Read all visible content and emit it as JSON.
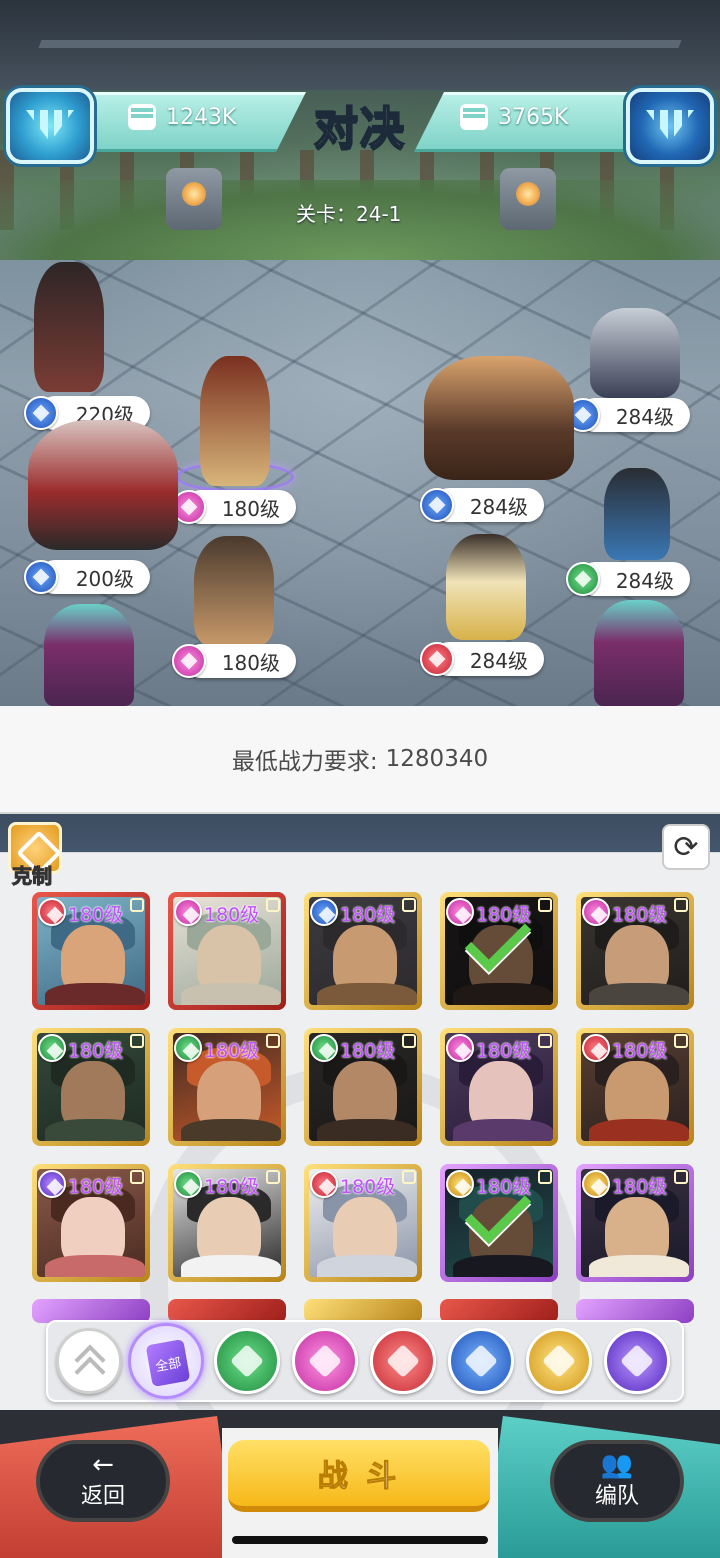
{
  "header": {
    "left_power": "1243K",
    "right_power": "3765K",
    "title": "对决",
    "stage": "关卡：24-1"
  },
  "arena": {
    "left_team": [
      {
        "level": "220级",
        "faction": "blue"
      },
      {
        "level": "180级",
        "faction": "pink"
      },
      {
        "level": "200级",
        "faction": "blue"
      },
      {
        "level": "180级",
        "faction": "pink"
      }
    ],
    "right_team": [
      {
        "level": "284级",
        "faction": "blue"
      },
      {
        "level": "284级",
        "faction": "blue"
      },
      {
        "level": "284级",
        "faction": "green"
      },
      {
        "level": "284级",
        "faction": "red"
      }
    ]
  },
  "requirement": {
    "label": "最低战力要求:",
    "value": "1280340"
  },
  "roster_controls": {
    "counter_label": "克制",
    "refresh_icon": "refresh-icon"
  },
  "roster": [
    {
      "level": "180级",
      "faction": "red",
      "frame": "red",
      "selected": false
    },
    {
      "level": "180级",
      "faction": "pink",
      "frame": "red",
      "selected": false
    },
    {
      "level": "180级",
      "faction": "blue",
      "frame": "gold",
      "selected": false
    },
    {
      "level": "180级",
      "faction": "pink",
      "frame": "gold",
      "selected": true
    },
    {
      "level": "180级",
      "faction": "pink",
      "frame": "gold",
      "selected": false
    },
    {
      "level": "180级",
      "faction": "green",
      "frame": "gold",
      "selected": false
    },
    {
      "level": "180级",
      "faction": "green",
      "frame": "gold",
      "selected": false
    },
    {
      "level": "180级",
      "faction": "green",
      "frame": "gold",
      "selected": false
    },
    {
      "level": "180级",
      "faction": "pink",
      "frame": "gold",
      "selected": false
    },
    {
      "level": "180级",
      "faction": "red",
      "frame": "gold",
      "selected": false
    },
    {
      "level": "180级",
      "faction": "purple",
      "frame": "gold",
      "selected": false
    },
    {
      "level": "180级",
      "faction": "green",
      "frame": "gold",
      "selected": false
    },
    {
      "level": "180级",
      "faction": "red",
      "frame": "gold",
      "selected": false
    },
    {
      "level": "180级",
      "faction": "gold",
      "frame": "purple",
      "selected": true
    },
    {
      "level": "180级",
      "faction": "gold",
      "frame": "purple",
      "selected": false
    }
  ],
  "filters": {
    "all_label": "全部",
    "items": [
      "collapse",
      "all",
      "green",
      "pink",
      "red",
      "blue",
      "gold",
      "purple"
    ]
  },
  "bottom": {
    "back_label": "返回",
    "fight_label": "战 斗",
    "formation_label": "编队",
    "back_icon": "←",
    "formation_icon": "8͡3"
  },
  "colors": {
    "accent_teal": "#7fd3c8",
    "fight_yellow": "#f7b819",
    "back_red": "#ef6d5a",
    "formation_teal": "#5ccfc7"
  }
}
